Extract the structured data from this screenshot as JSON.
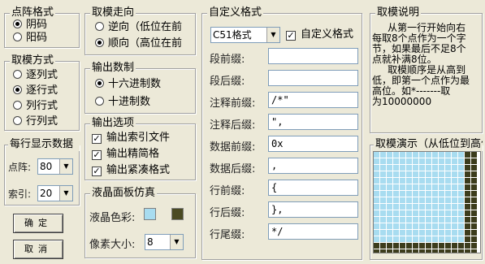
{
  "dot_format": {
    "title": "点阵格式",
    "options": [
      "阴码",
      "阳码"
    ],
    "selected": 0
  },
  "scan_mode": {
    "title": "取模方式",
    "options": [
      "逐列式",
      "逐行式",
      "列行式",
      "行列式"
    ],
    "selected": 1
  },
  "per_line": {
    "title": "每行显示数据",
    "dot_label": "点阵:",
    "dot_value": "80",
    "index_label": "索引:",
    "index_value": "20"
  },
  "buttons": {
    "ok": "确定",
    "cancel": "取消"
  },
  "direction": {
    "title": "取模走向",
    "options": [
      "逆向（低位在前",
      "顺向（高位在前"
    ],
    "selected": 1
  },
  "output_radix": {
    "title": "输出数制",
    "options": [
      "十六进制数",
      "十进制数"
    ],
    "selected": 0
  },
  "output_opts": {
    "title": "输出选项",
    "items": [
      "输出索引文件",
      "输出精简格",
      "输出紧凑格式"
    ],
    "checked": [
      true,
      true,
      true
    ]
  },
  "lcd_sim": {
    "title": "液晶面板仿真",
    "color_label": "液晶色彩:",
    "color_on": "#a8dcf0",
    "color_off": "#4a4a22",
    "pixel_label": "像素大小:",
    "pixel_value": "8"
  },
  "custom_format": {
    "title": "自定义格式",
    "preset": "C51格式",
    "custom_check_label": "自定义格式",
    "custom_checked": true,
    "fields": [
      {
        "label": "段前缀:",
        "value": ""
      },
      {
        "label": "段后缀:",
        "value": ""
      },
      {
        "label": "注释前缀:",
        "value": "/*\""
      },
      {
        "label": "注释后缀:",
        "value": "\","
      },
      {
        "label": "数据前缀:",
        "value": "0x"
      },
      {
        "label": "数据后缀:",
        "value": ","
      },
      {
        "label": "行前缀:",
        "value": "{"
      },
      {
        "label": "行后缀:",
        "value": "},"
      },
      {
        "label": "行尾缀:",
        "value": "*/"
      }
    ]
  },
  "description": {
    "title": "取模说明",
    "text": "     从第一行开始向右\n每取8个点作为一个字\n节，如果最后不足8个\n点就补满8位。\n     取模顺序是从高到\n低，即第一个点作为最\n高位。如*-------取\n为10000000"
  },
  "demo": {
    "title": "取模演示（从低位到高位）",
    "rows": 17,
    "cols": 16,
    "lit_rows": 14,
    "lit_cols": 14,
    "color_on": "#a8dcf0",
    "color_off": "#3c3c1c"
  }
}
